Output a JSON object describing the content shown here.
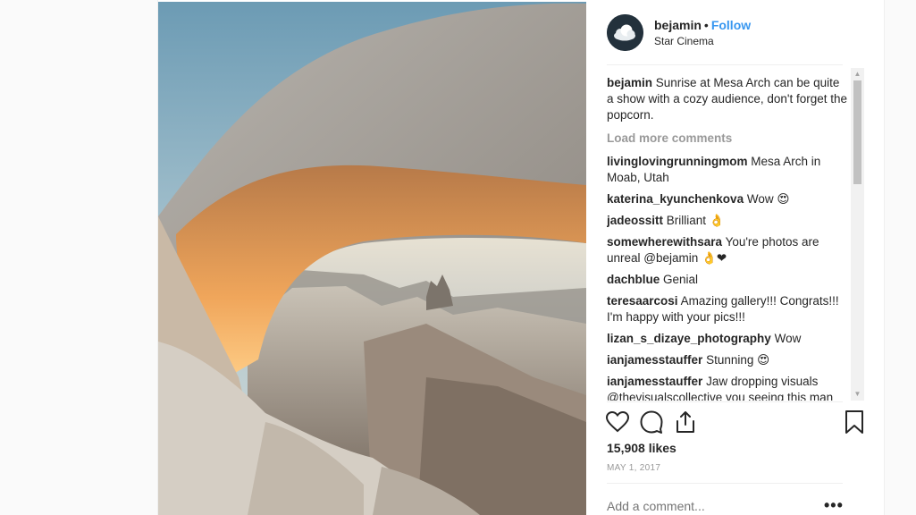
{
  "header": {
    "username": "bejamin",
    "separator": "•",
    "follow_label": "Follow",
    "location": "Star Cinema"
  },
  "caption": {
    "username": "bejamin",
    "text": "Sunrise at Mesa Arch can be quite a show with a cozy audience, don't forget the popcorn."
  },
  "load_more_label": "Load more comments",
  "comments": [
    {
      "username": "livinglovingrunningmom",
      "text": "Mesa Arch in Moab, Utah"
    },
    {
      "username": "katerina_kyunchenkova",
      "text": "Wow 😍"
    },
    {
      "username": "jadeossitt",
      "text": "Brilliant 👌"
    },
    {
      "username": "somewherewithsara",
      "text": "You're photos are unreal @bejamin 👌❤"
    },
    {
      "username": "dachblue",
      "text": "Genial"
    },
    {
      "username": "teresaarcosi",
      "text": "Amazing gallery!!! Congrats!!! I'm happy with your pics!!!"
    },
    {
      "username": "lizan_s_dizaye_photography",
      "text": "Wow"
    },
    {
      "username": "ianjamesstauffer",
      "text": "Stunning 😍"
    },
    {
      "username": "ianjamesstauffer",
      "text": "Jaw dropping visuals @thevisualscollective you seeing this man"
    }
  ],
  "likes_label": "15,908 likes",
  "date_label": "MAY 1, 2017",
  "add_comment_placeholder": "Add a comment...",
  "more_label": "•••",
  "icons": {
    "like": "heart-icon",
    "comment": "comment-icon",
    "share": "share-icon",
    "save": "bookmark-icon",
    "avatar": "cloud-avatar"
  },
  "colors": {
    "follow": "#3897f0",
    "muted": "#999999",
    "text": "#262626"
  }
}
